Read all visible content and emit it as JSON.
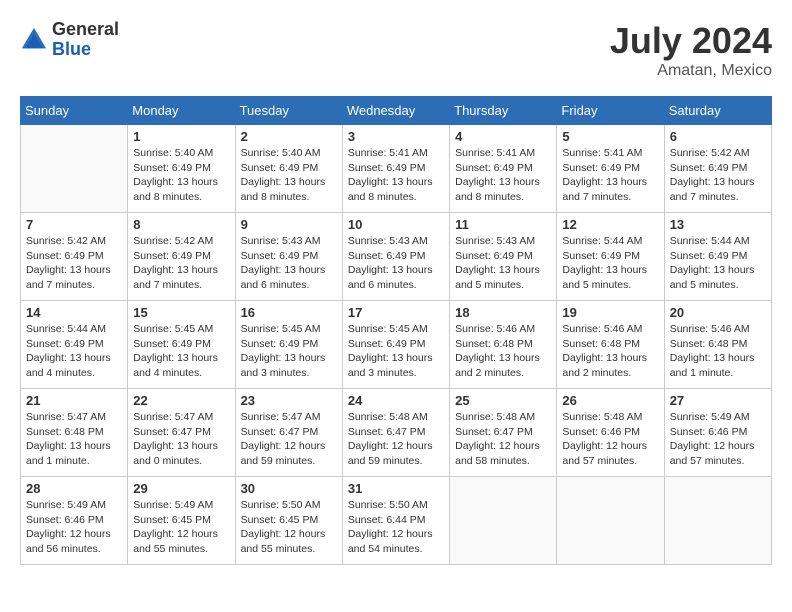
{
  "header": {
    "logo_general": "General",
    "logo_blue": "Blue",
    "month": "July 2024",
    "location": "Amatan, Mexico"
  },
  "calendar": {
    "days_of_week": [
      "Sunday",
      "Monday",
      "Tuesday",
      "Wednesday",
      "Thursday",
      "Friday",
      "Saturday"
    ],
    "weeks": [
      [
        {
          "day": "",
          "info": ""
        },
        {
          "day": "1",
          "info": "Sunrise: 5:40 AM\nSunset: 6:49 PM\nDaylight: 13 hours\nand 8 minutes."
        },
        {
          "day": "2",
          "info": "Sunrise: 5:40 AM\nSunset: 6:49 PM\nDaylight: 13 hours\nand 8 minutes."
        },
        {
          "day": "3",
          "info": "Sunrise: 5:41 AM\nSunset: 6:49 PM\nDaylight: 13 hours\nand 8 minutes."
        },
        {
          "day": "4",
          "info": "Sunrise: 5:41 AM\nSunset: 6:49 PM\nDaylight: 13 hours\nand 8 minutes."
        },
        {
          "day": "5",
          "info": "Sunrise: 5:41 AM\nSunset: 6:49 PM\nDaylight: 13 hours\nand 7 minutes."
        },
        {
          "day": "6",
          "info": "Sunrise: 5:42 AM\nSunset: 6:49 PM\nDaylight: 13 hours\nand 7 minutes."
        }
      ],
      [
        {
          "day": "7",
          "info": "Sunrise: 5:42 AM\nSunset: 6:49 PM\nDaylight: 13 hours\nand 7 minutes."
        },
        {
          "day": "8",
          "info": "Sunrise: 5:42 AM\nSunset: 6:49 PM\nDaylight: 13 hours\nand 7 minutes."
        },
        {
          "day": "9",
          "info": "Sunrise: 5:43 AM\nSunset: 6:49 PM\nDaylight: 13 hours\nand 6 minutes."
        },
        {
          "day": "10",
          "info": "Sunrise: 5:43 AM\nSunset: 6:49 PM\nDaylight: 13 hours\nand 6 minutes."
        },
        {
          "day": "11",
          "info": "Sunrise: 5:43 AM\nSunset: 6:49 PM\nDaylight: 13 hours\nand 5 minutes."
        },
        {
          "day": "12",
          "info": "Sunrise: 5:44 AM\nSunset: 6:49 PM\nDaylight: 13 hours\nand 5 minutes."
        },
        {
          "day": "13",
          "info": "Sunrise: 5:44 AM\nSunset: 6:49 PM\nDaylight: 13 hours\nand 5 minutes."
        }
      ],
      [
        {
          "day": "14",
          "info": "Sunrise: 5:44 AM\nSunset: 6:49 PM\nDaylight: 13 hours\nand 4 minutes."
        },
        {
          "day": "15",
          "info": "Sunrise: 5:45 AM\nSunset: 6:49 PM\nDaylight: 13 hours\nand 4 minutes."
        },
        {
          "day": "16",
          "info": "Sunrise: 5:45 AM\nSunset: 6:49 PM\nDaylight: 13 hours\nand 3 minutes."
        },
        {
          "day": "17",
          "info": "Sunrise: 5:45 AM\nSunset: 6:49 PM\nDaylight: 13 hours\nand 3 minutes."
        },
        {
          "day": "18",
          "info": "Sunrise: 5:46 AM\nSunset: 6:48 PM\nDaylight: 13 hours\nand 2 minutes."
        },
        {
          "day": "19",
          "info": "Sunrise: 5:46 AM\nSunset: 6:48 PM\nDaylight: 13 hours\nand 2 minutes."
        },
        {
          "day": "20",
          "info": "Sunrise: 5:46 AM\nSunset: 6:48 PM\nDaylight: 13 hours\nand 1 minute."
        }
      ],
      [
        {
          "day": "21",
          "info": "Sunrise: 5:47 AM\nSunset: 6:48 PM\nDaylight: 13 hours\nand 1 minute."
        },
        {
          "day": "22",
          "info": "Sunrise: 5:47 AM\nSunset: 6:47 PM\nDaylight: 13 hours\nand 0 minutes."
        },
        {
          "day": "23",
          "info": "Sunrise: 5:47 AM\nSunset: 6:47 PM\nDaylight: 12 hours\nand 59 minutes."
        },
        {
          "day": "24",
          "info": "Sunrise: 5:48 AM\nSunset: 6:47 PM\nDaylight: 12 hours\nand 59 minutes."
        },
        {
          "day": "25",
          "info": "Sunrise: 5:48 AM\nSunset: 6:47 PM\nDaylight: 12 hours\nand 58 minutes."
        },
        {
          "day": "26",
          "info": "Sunrise: 5:48 AM\nSunset: 6:46 PM\nDaylight: 12 hours\nand 57 minutes."
        },
        {
          "day": "27",
          "info": "Sunrise: 5:49 AM\nSunset: 6:46 PM\nDaylight: 12 hours\nand 57 minutes."
        }
      ],
      [
        {
          "day": "28",
          "info": "Sunrise: 5:49 AM\nSunset: 6:46 PM\nDaylight: 12 hours\nand 56 minutes."
        },
        {
          "day": "29",
          "info": "Sunrise: 5:49 AM\nSunset: 6:45 PM\nDaylight: 12 hours\nand 55 minutes."
        },
        {
          "day": "30",
          "info": "Sunrise: 5:50 AM\nSunset: 6:45 PM\nDaylight: 12 hours\nand 55 minutes."
        },
        {
          "day": "31",
          "info": "Sunrise: 5:50 AM\nSunset: 6:44 PM\nDaylight: 12 hours\nand 54 minutes."
        },
        {
          "day": "",
          "info": ""
        },
        {
          "day": "",
          "info": ""
        },
        {
          "day": "",
          "info": ""
        }
      ]
    ]
  }
}
